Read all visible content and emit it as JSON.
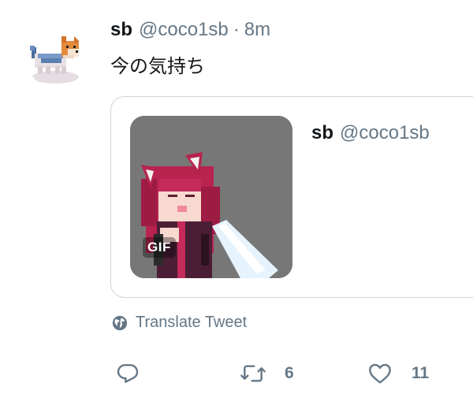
{
  "tweet": {
    "display_name": "sb",
    "handle": "@coco1sb",
    "separator": "·",
    "time": "8m",
    "text": "今の気持ち"
  },
  "quote": {
    "display_name": "sb",
    "handle": "@coco1sb",
    "media_badge": "GIF"
  },
  "translate_label": "Translate Tweet",
  "actions": {
    "reply_icon": "reply-icon",
    "retweet_icon": "retweet-icon",
    "retweet_count": "6",
    "like_icon": "heart-icon",
    "like_count": "11"
  },
  "colors": {
    "text": "#14171a",
    "secondary": "#657786",
    "border": "#ccd6dd",
    "media_bg": "#777777"
  }
}
